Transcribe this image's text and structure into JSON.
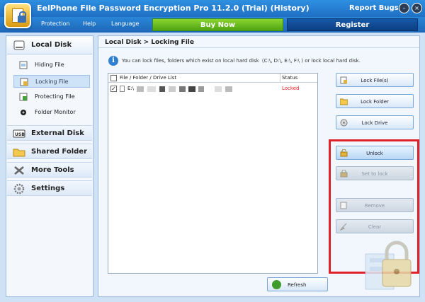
{
  "window": {
    "title": "EelPhone File Password Encryption Pro 11.2.0 (Trial) (History)",
    "report_bugs": "Report Bugs",
    "controls": {
      "minimize": "–",
      "close": "×"
    }
  },
  "menu": {
    "items": [
      "Protection",
      "Help",
      "Language"
    ],
    "buy_now": "Buy Now",
    "register": "Register"
  },
  "sidebar": {
    "local_disk": "Local Disk",
    "sub_items": [
      {
        "label": "Hiding File",
        "icon": "hide-file-icon"
      },
      {
        "label": "Locking File",
        "icon": "lock-file-icon"
      },
      {
        "label": "Protecting File",
        "icon": "protect-file-icon"
      },
      {
        "label": "Folder Monitor",
        "icon": "monitor-icon"
      }
    ],
    "sections": [
      {
        "label": "External Disk",
        "icon": "usb-icon"
      },
      {
        "label": "Shared Folder",
        "icon": "folder-icon"
      },
      {
        "label": "More Tools",
        "icon": "tools-icon"
      },
      {
        "label": "Settings",
        "icon": "gear-icon"
      }
    ]
  },
  "content": {
    "breadcrumb": "Local Disk > Locking File",
    "info_text": "You can lock files, folders which exist on local hard disk（C:\\, D:\\, E:\\, F:\\ ) or lock local hard disk.",
    "list": {
      "col_name": "File / Folder / Drive List",
      "col_status": "Status",
      "rows": [
        {
          "path": "E:\\",
          "status": "Locked",
          "checked": "✓"
        }
      ]
    },
    "buttons": {
      "lock_files": "Lock File(s)",
      "lock_folder": "Lock Folder",
      "lock_drive": "Lock Drive",
      "unlock": "Unlock",
      "set_to_lock": "Set to lock",
      "remove": "Remove",
      "clear": "Clear",
      "refresh": "Refresh"
    }
  },
  "colors": {
    "title_blue": "#1f6fc4",
    "buy_green": "#4ea414",
    "register_blue": "#0d3f80",
    "status_red": "#e22222",
    "highlight_red": "#e2222a"
  }
}
